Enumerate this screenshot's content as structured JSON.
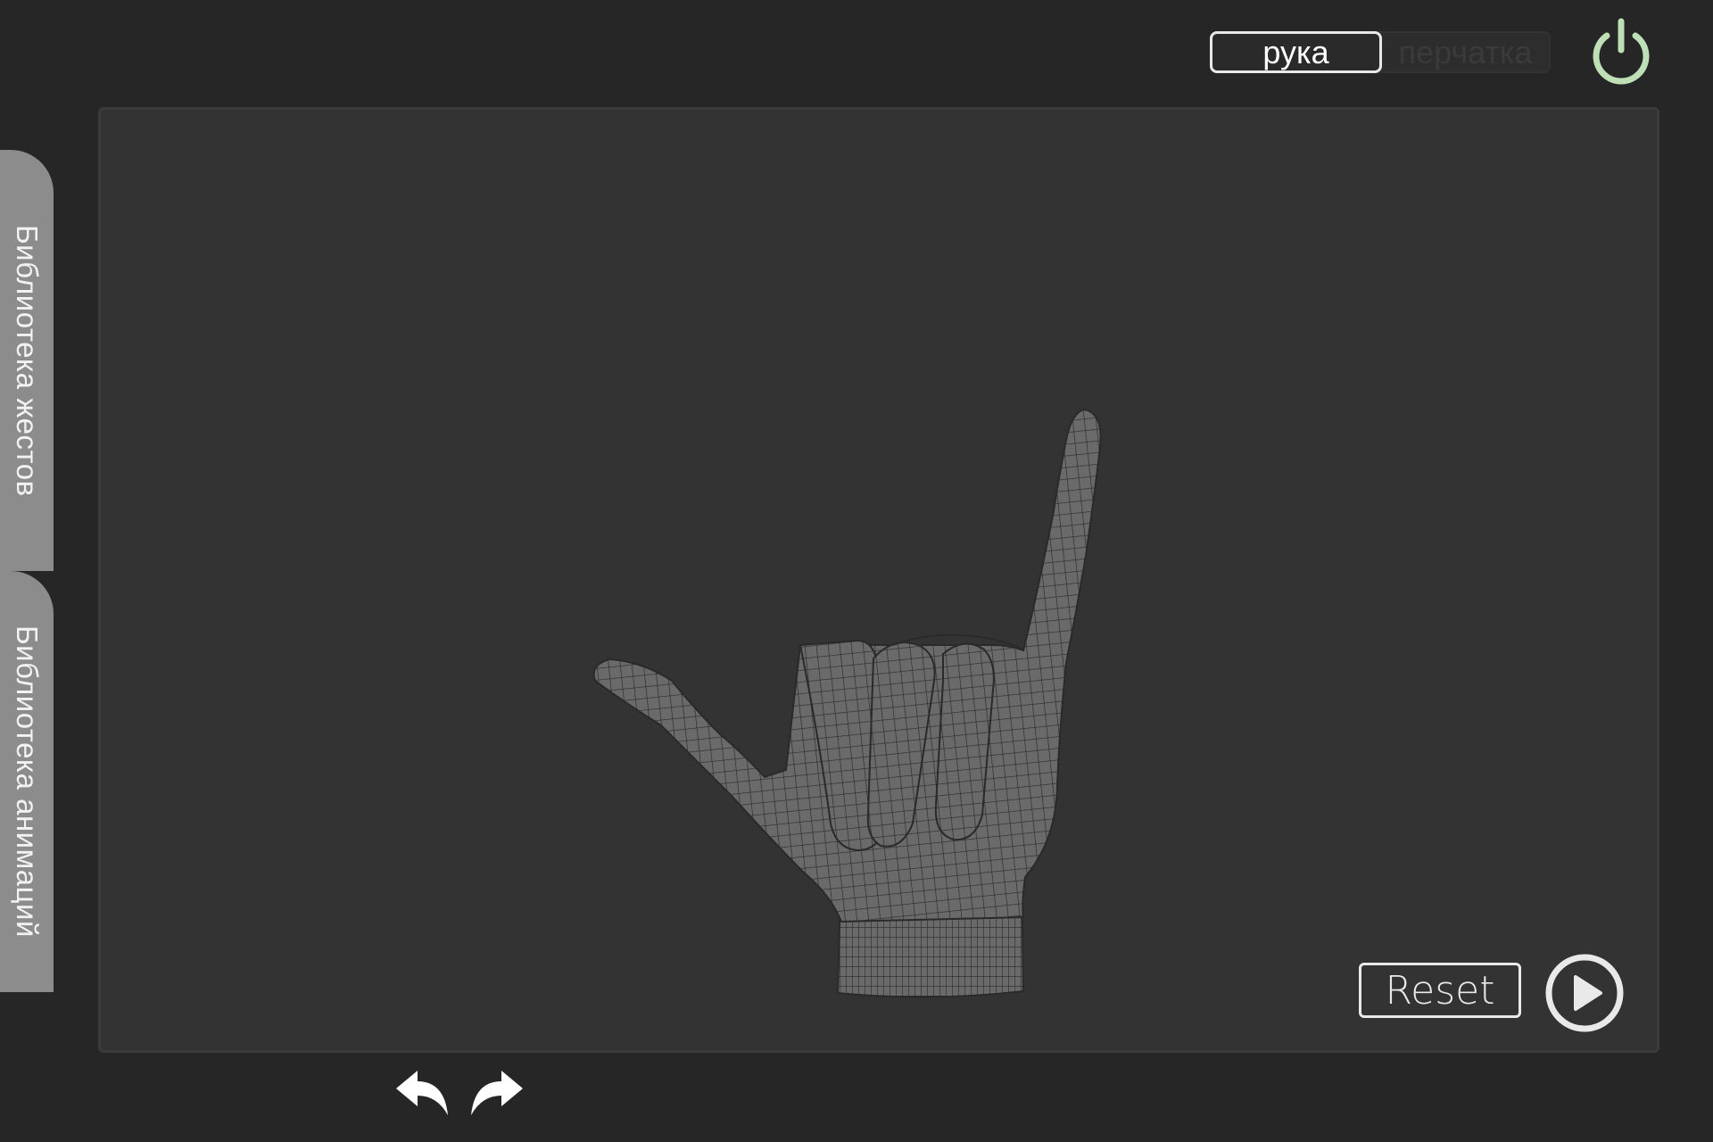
{
  "mode_toggle": {
    "options": [
      {
        "label": "рука",
        "active": true
      },
      {
        "label": "перчатка",
        "active": false
      }
    ]
  },
  "power": {
    "icon": "power-icon",
    "color": "#bfe0b6"
  },
  "side_tabs": [
    {
      "label": "Библиотека жестов"
    },
    {
      "label": "Библиотека анимаций"
    }
  ],
  "viewport": {
    "model": "hand-wireframe"
  },
  "controls": {
    "reset_label": "Reset",
    "play_icon": "play-icon"
  },
  "history": {
    "undo_icon": "undo-icon",
    "redo_icon": "redo-icon"
  }
}
